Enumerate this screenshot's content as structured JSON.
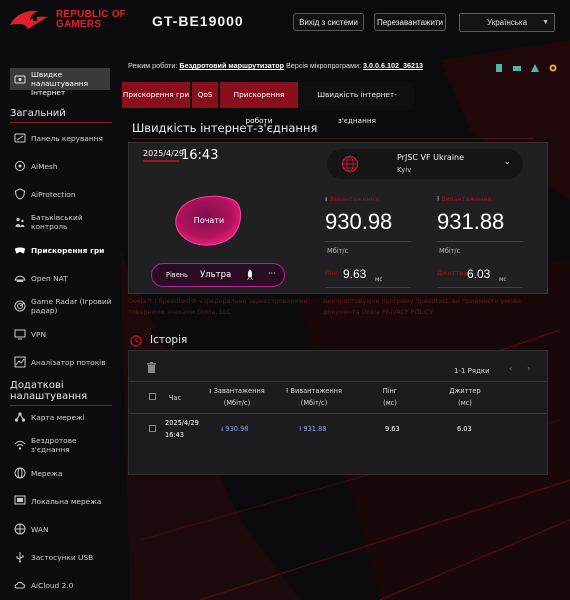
{
  "header": {
    "brand_line1": "REPUBLIC OF",
    "brand_line2": "GAMERS",
    "model": "GT-BE19000",
    "logout": "Вихід з системи",
    "reboot": "Перезавантажити",
    "language": "Українська"
  },
  "sidebar": {
    "quick_setup": "Швидке налаштування Інтернет",
    "general_title": "Загальний",
    "general_items": [
      {
        "label": "Панель керування",
        "icon": "dashboard-icon"
      },
      {
        "label": "AiMesh",
        "icon": "aimesh-icon"
      },
      {
        "label": "AiProtection",
        "icon": "shield-icon"
      },
      {
        "label": "Батьківський контроль",
        "icon": "parental-icon"
      },
      {
        "label": "Прискорення гри",
        "icon": "gamepad-icon",
        "active": true
      },
      {
        "label": "Open NAT",
        "icon": "open-nat-icon"
      },
      {
        "label": "Game Radar (Ігровий радар)",
        "icon": "radar-icon"
      },
      {
        "label": "VPN",
        "icon": "vpn-icon"
      },
      {
        "label": "Аналізатор потоків",
        "icon": "traffic-icon"
      }
    ],
    "advanced_title": "Додаткові налаштування",
    "advanced_items": [
      {
        "label": "Карта мережі",
        "icon": "network-map-icon"
      },
      {
        "label": "Бездротове з'єднання",
        "icon": "wireless-icon"
      },
      {
        "label": "Мережа",
        "icon": "network-icon"
      },
      {
        "label": "Локальна мережа",
        "icon": "lan-icon"
      },
      {
        "label": "WAN",
        "icon": "wan-icon"
      },
      {
        "label": "Застосунки USB",
        "icon": "usb-icon"
      },
      {
        "label": "AiCloud 2.0",
        "icon": "cloud-icon"
      }
    ]
  },
  "status": {
    "mode_label": "Режим роботи:",
    "mode_value": "Бездротовий маршрутизатор",
    "fw_label": "Версія мікропрограми:",
    "fw_value": "3.0.0.6.102_36213"
  },
  "tabs": [
    {
      "label": "Прискорення гри"
    },
    {
      "label": "QoS"
    },
    {
      "label": "Прискорення роботи"
    },
    {
      "label": "Швидкість інтернет-з'єднання",
      "selected": true
    }
  ],
  "speedtest": {
    "title": "Швидкість інтернет-з'єднання",
    "date": "2025/4/29",
    "time": "16:43",
    "server_name": "PrJSC VF Ukraine",
    "server_city": "Kyiv",
    "go_label": "Почати",
    "download_label": "Завантаження",
    "download_value": "930.98",
    "download_unit": "Мбіт/с",
    "upload_label": "Вивантаження",
    "upload_value": "931.88",
    "upload_unit": "Мбіт/с",
    "ping_label": "Пінг",
    "ping_value": "9.63",
    "ping_unit": "мс",
    "jitter_label": "Джиттер",
    "jitter_value": "6.03",
    "jitter_unit": "мс",
    "level_label": "Рівень",
    "level_value": "Ультра",
    "more": "···",
    "disclaimer_left_1": "Ookla® і Speedtest® є федерально зареєстрованими",
    "disclaimer_left_2": "товарними знаками Ookla, LLC",
    "disclaimer_right_1": "Використовуючи програму Speedtest, ви приймаєте умови",
    "disclaimer_right_2": "документа Ookla PRIVACY POLICY"
  },
  "history": {
    "title": "Історія",
    "rows_label": "1-1 Рядки",
    "columns": [
      {
        "line1": "Час",
        "line2": ""
      },
      {
        "line1": "Завантаження",
        "line2": "(Мбіт/с)"
      },
      {
        "line1": "Вивантаження",
        "line2": "(Мбіт/с)"
      },
      {
        "line1": "Пінг",
        "line2": "(мс)"
      },
      {
        "line1": "Джиттер",
        "line2": "(мс)"
      }
    ],
    "rows": [
      {
        "date": "2025/4/29",
        "time": "16:43",
        "download": "930.98",
        "upload": "931.88",
        "ping": "9.63",
        "jitter": "6.03"
      }
    ]
  },
  "colors": {
    "accent": "#a3121f",
    "tab": "#8a0f1c",
    "background": "#0b0b0d"
  }
}
